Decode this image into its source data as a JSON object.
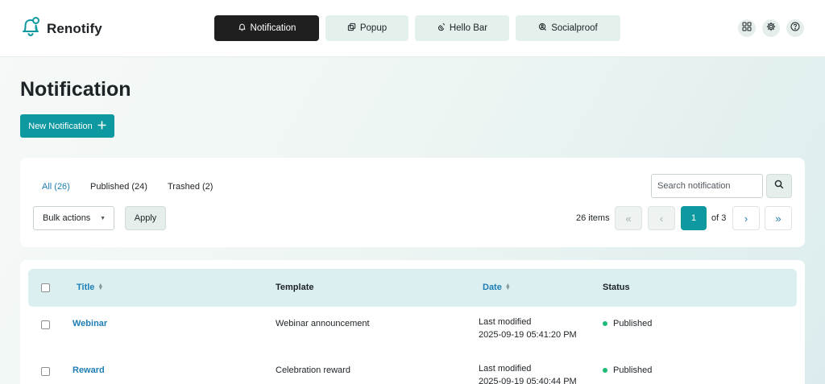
{
  "app": {
    "name": "Renotify",
    "nav": [
      {
        "label": "Notification",
        "icon": "bell-icon",
        "active": true
      },
      {
        "label": "Popup",
        "icon": "popup-icon",
        "active": false
      },
      {
        "label": "Hello Bar",
        "icon": "hand-wave-icon",
        "active": false
      },
      {
        "label": "Socialproof",
        "icon": "socialproof-icon",
        "active": false
      }
    ],
    "header_icons": [
      "grid-icon",
      "gear-icon",
      "help-icon"
    ]
  },
  "page": {
    "title": "Notification",
    "new_button": "New Notification"
  },
  "filters": {
    "all": "All (26)",
    "published": "Published (24)",
    "trashed": "Trashed (2)"
  },
  "search": {
    "placeholder": "Search notification"
  },
  "bulk": {
    "selected": "Bulk actions",
    "apply_label": "Apply"
  },
  "pagination": {
    "items": "26 items",
    "first": "«",
    "prev": "‹",
    "current": "1",
    "of": "of 3",
    "next": "›",
    "last": "»"
  },
  "table": {
    "columns": {
      "title": "Title",
      "template": "Template",
      "date": "Date",
      "status": "Status"
    },
    "rows": [
      {
        "title": "Webinar",
        "template": "Webinar announcement",
        "date_label": "Last modified",
        "date": "2025-09-19 05:41:20 PM",
        "status": "Published"
      },
      {
        "title": "Reward",
        "template": "Celebration reward",
        "date_label": "Last modified",
        "date": "2025-09-19 05:40:44 PM",
        "status": "Published"
      }
    ]
  },
  "colors": {
    "accent": "#0e98a0",
    "link": "#1d7eb4",
    "published": "#1fb978",
    "active_tab": "#1f1f1f"
  }
}
